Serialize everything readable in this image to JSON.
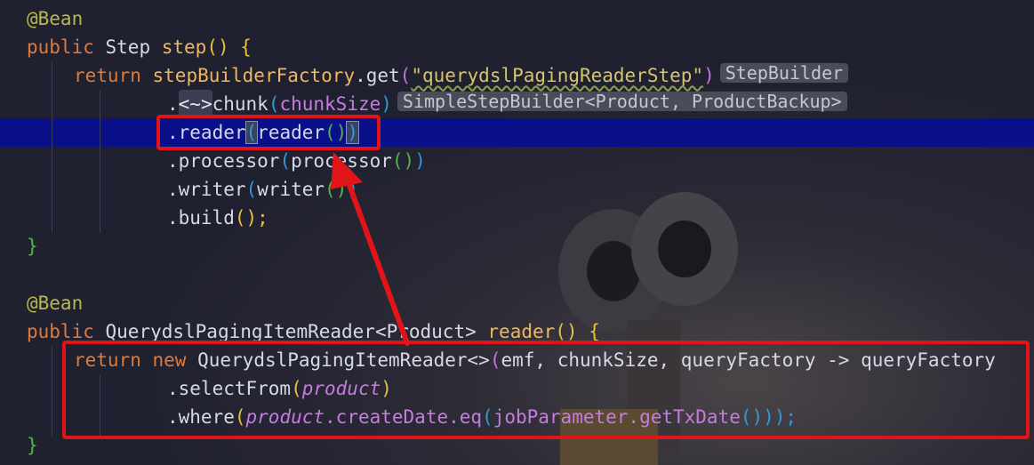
{
  "editor": {
    "lines": {
      "l1": {
        "annotation": "@Bean"
      },
      "l2": {
        "kw": "public",
        "type": "Step",
        "method": "step",
        "paren_open": "(",
        "paren_close": ")",
        "brace": "{"
      },
      "l3": {
        "kw": "return",
        "call": "stepBuilderFactory",
        "dot_get": ".get",
        "str": "\"querydslPagingReaderStep\"",
        "hint": "StepBuilder"
      },
      "l4": {
        "dot": ".",
        "fold": "<~>",
        "method": "chunk",
        "arg": "chunkSize",
        "hint": "SimpleStepBuilder<Product, ProductBackup>"
      },
      "l5": {
        "method": ".reader",
        "arg": "reader",
        "call": "()"
      },
      "l6": {
        "method": ".processor",
        "arg": "processor",
        "call": "()"
      },
      "l7": {
        "method": ".writer",
        "arg": "writer",
        "call": "()"
      },
      "l8": {
        "method": ".build",
        "end": "();"
      },
      "l9": {
        "brace": "}"
      },
      "l11": {
        "annotation": "@Bean"
      },
      "l12": {
        "kw": "public",
        "type": "QuerydslPagingItemReader<Product>",
        "method": "reader",
        "paren": "()",
        "brace": "{"
      },
      "l13": {
        "kw1": "return",
        "kw2": "new",
        "type": "QuerydslPagingItemReader<>",
        "args": "emf, chunkSize, queryFactory -> queryFactory"
      },
      "l14": {
        "method": ".selectFrom",
        "arg": "product"
      },
      "l15": {
        "method": ".where",
        "field": "product",
        "chain": ".createDate.eq",
        "param": "jobParameter.getTxDate",
        "end": "()));"
      },
      "l16": {
        "brace": "}"
      }
    }
  },
  "annotations": {
    "box_color": "#e2141a",
    "arrow_color": "#e2141a"
  }
}
